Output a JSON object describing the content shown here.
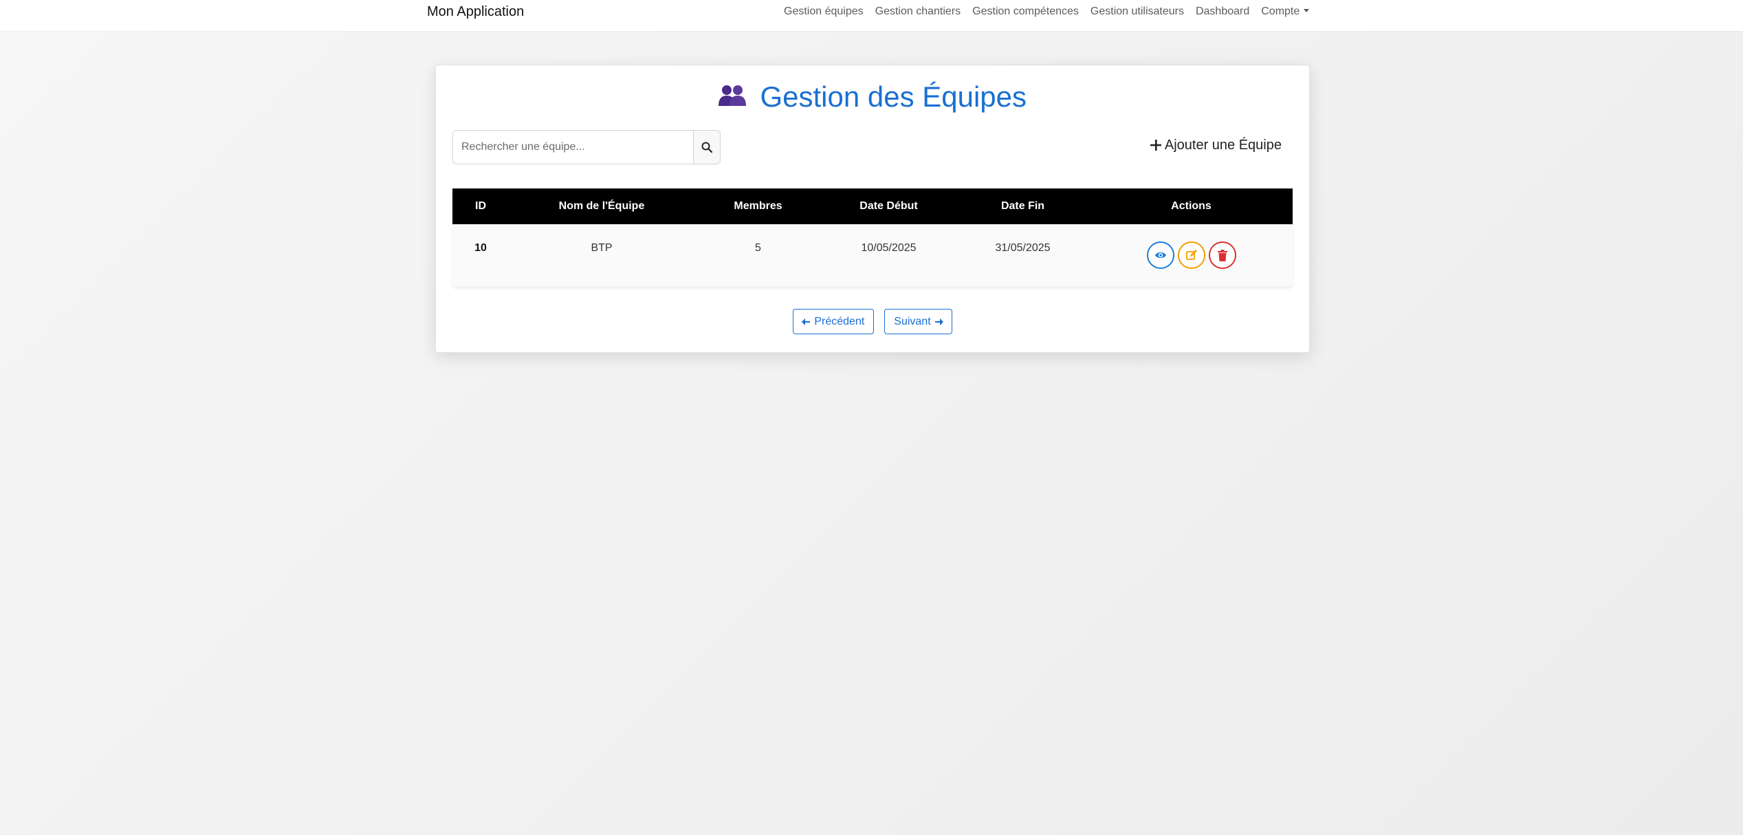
{
  "navbar": {
    "brand": "Mon Application",
    "links": [
      "Gestion équipes",
      "Gestion chantiers",
      "Gestion compétences",
      "Gestion utilisateurs",
      "Dashboard",
      "Compte"
    ]
  },
  "page": {
    "title": "Gestion des Équipes",
    "title_icon": "users-icon",
    "title_color": "#1a6fd3"
  },
  "search": {
    "placeholder": "Rechercher une équipe...",
    "value": "",
    "icon": "search-icon"
  },
  "add_button": {
    "label": "Ajouter une Équipe",
    "icon": "plus-icon"
  },
  "table": {
    "headers": [
      "ID",
      "Nom de l'Équipe",
      "Membres",
      "Date Début",
      "Date Fin",
      "Actions"
    ],
    "rows": [
      {
        "id": "10",
        "name": "BTP",
        "members": "5",
        "start": "10/05/2025",
        "end": "31/05/2025",
        "actions": [
          {
            "icon": "eye-icon",
            "color": "#1a7fd8"
          },
          {
            "icon": "edit-icon",
            "color": "#f0a000"
          },
          {
            "icon": "trash-icon",
            "color": "#dc3030"
          }
        ]
      }
    ]
  },
  "pagination": {
    "prev_label": "Précédent",
    "next_label": "Suivant",
    "color": "#1a6fd3"
  }
}
